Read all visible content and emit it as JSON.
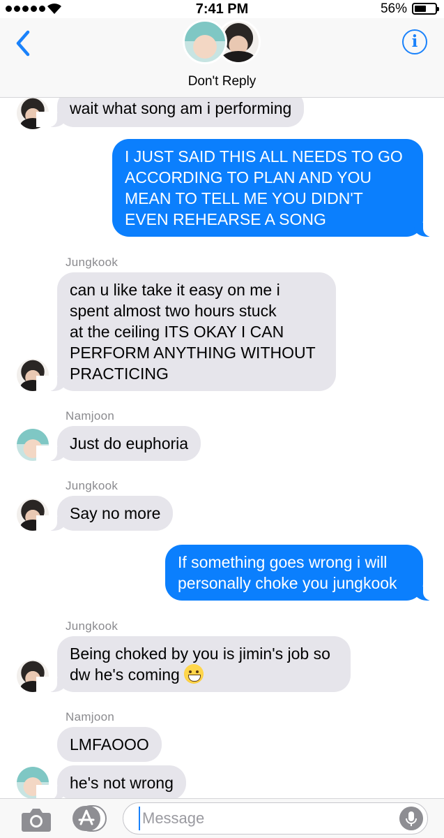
{
  "status_bar": {
    "time": "7:41 PM",
    "battery_percent_label": "56%",
    "battery_level": 0.56,
    "signal_dots": 5,
    "wifi_icon": "wifi-icon"
  },
  "header": {
    "title": "Don't Reply",
    "back_icon": "chevron-left-icon",
    "info_icon": "info-icon",
    "info_glyph": "i",
    "accent_color": "#1a82fb"
  },
  "messages": [
    {
      "direction": "in",
      "sender": "",
      "avatar": "jungkook",
      "text": "wait what song am i performing"
    },
    {
      "direction": "out",
      "text_lines": [
        "I JUST SAID THIS ALL NEEDS TO GO",
        "ACCORDING TO PLAN AND YOU",
        "MEAN TO TELL ME YOU DIDN'T",
        "EVEN REHEARSE A SONG"
      ]
    },
    {
      "direction": "in",
      "sender": "Jungkook",
      "avatar": "jungkook",
      "text_lines": [
        "can u like take it easy on me i",
        "spent almost two hours stuck",
        "at the ceiling ITS OKAY I CAN",
        "PERFORM ANYTHING WITHOUT",
        "PRACTICING"
      ]
    },
    {
      "direction": "in",
      "sender": "Namjoon",
      "avatar": "namjoon",
      "text": "Just do euphoria"
    },
    {
      "direction": "in",
      "sender": "Jungkook",
      "avatar": "jungkook",
      "text": "Say no more"
    },
    {
      "direction": "out",
      "text_lines": [
        "If something goes wrong i will",
        "personally choke you jungkook"
      ]
    },
    {
      "direction": "in",
      "sender": "Jungkook",
      "avatar": "jungkook",
      "text_lines": [
        "Being choked by you is jimin's job so",
        "dw he's coming"
      ],
      "emoji": "grinning-face-emoji"
    },
    {
      "direction": "in",
      "sender": "Namjoon",
      "avatar": "namjoon",
      "text": "LMFAOOO"
    },
    {
      "direction": "in",
      "sender": "",
      "avatar": "namjoon",
      "text": "he's not wrong"
    }
  ],
  "input_bar": {
    "placeholder": "Message",
    "camera_icon": "camera-icon",
    "apps_icon": "app-store-icon",
    "mic_icon": "microphone-icon"
  },
  "colors": {
    "outgoing_bubble": "#0b7ffd",
    "incoming_bubble": "#e6e5eb",
    "sender_name": "#8a8a8e"
  }
}
